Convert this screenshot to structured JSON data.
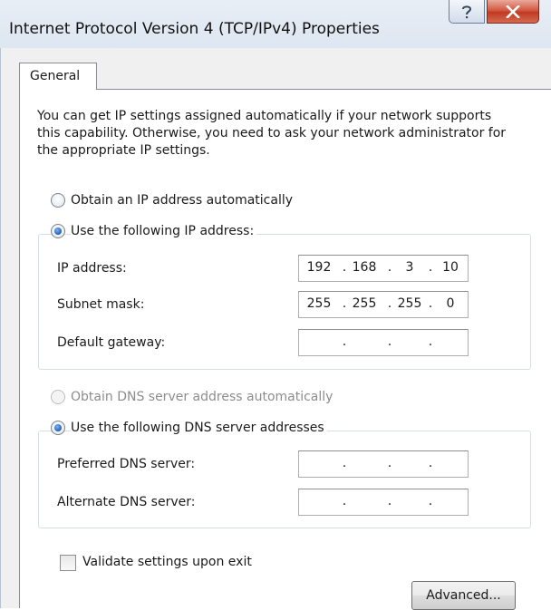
{
  "window": {
    "title": "Internet Protocol Version 4 (TCP/IPv4) Properties",
    "help_icon": "question-mark",
    "close_icon": "x-close"
  },
  "tabs": [
    {
      "label": "General",
      "selected": true
    }
  ],
  "description": "You can get IP settings assigned automatically if your network supports this capability. Otherwise, you need to ask your network administrator for the appropriate IP settings.",
  "ip_section": {
    "auto_option": {
      "label": "Obtain an IP address automatically",
      "checked": false,
      "enabled": true
    },
    "manual_option": {
      "label": "Use the following IP address:",
      "checked": true,
      "enabled": true
    },
    "fields": [
      {
        "label": "IP address:",
        "octets": [
          "192",
          "168",
          "3",
          "10"
        ]
      },
      {
        "label": "Subnet mask:",
        "octets": [
          "255",
          "255",
          "255",
          "0"
        ]
      },
      {
        "label": "Default gateway:",
        "octets": [
          "",
          "",
          "",
          ""
        ]
      }
    ]
  },
  "dns_section": {
    "auto_option": {
      "label": "Obtain DNS server address automatically",
      "checked": false,
      "enabled": false
    },
    "manual_option": {
      "label": "Use the following DNS server addresses",
      "checked": true,
      "enabled": true
    },
    "fields": [
      {
        "label": "Preferred DNS server:",
        "octets": [
          "",
          "",
          "",
          ""
        ]
      },
      {
        "label": "Alternate DNS server:",
        "octets": [
          "",
          "",
          "",
          ""
        ]
      }
    ]
  },
  "validate_checkbox": {
    "label": "Validate settings upon exit",
    "checked": false
  },
  "advanced_button": {
    "label": "Advanced..."
  }
}
